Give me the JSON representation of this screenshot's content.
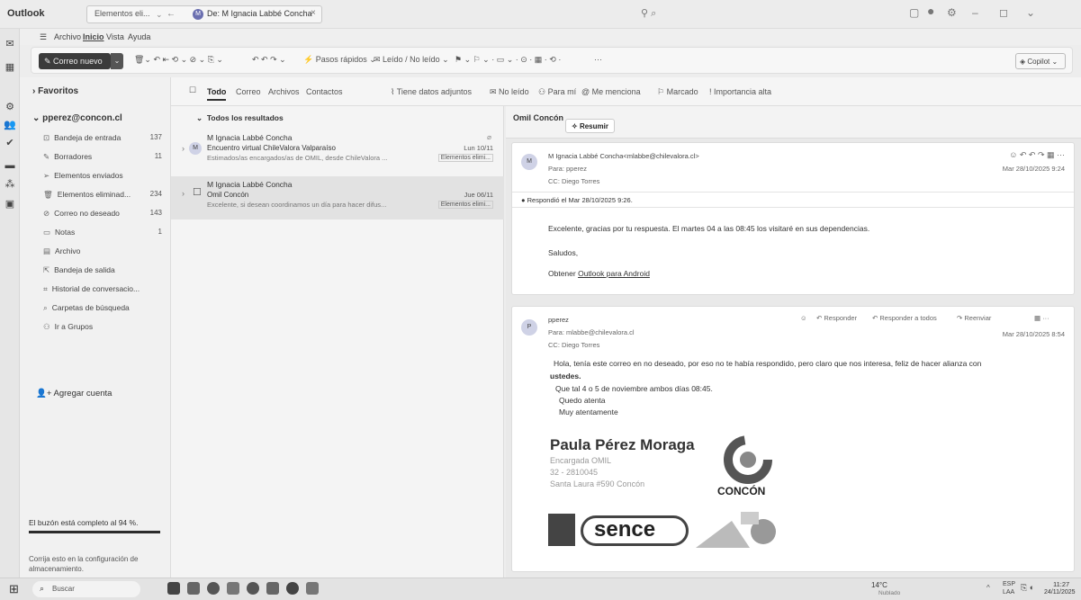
{
  "app": {
    "name": "Outlook"
  },
  "search": {
    "scope": "Elementos eli...",
    "query": "De: M Ignacia Labbé Concha",
    "avatar_initial": "M"
  },
  "menu": {
    "archivo": "Archivo",
    "inicio": "Inicio",
    "vista": "Vista",
    "ayuda": "Ayuda"
  },
  "ribbon": {
    "new_mail": "Correo nuevo",
    "quick_steps": "Pasos rápidos",
    "read_unread": "Leído / No leído",
    "more": "···",
    "copilot": "Copilot"
  },
  "folders": {
    "favorites": "Favoritos",
    "account": "pperez@concon.cl",
    "items": [
      {
        "label": "Bandeja de entrada",
        "count": "137",
        "icon": "inbox-icon"
      },
      {
        "label": "Borradores",
        "count": "11",
        "icon": "pencil-icon"
      },
      {
        "label": "Elementos enviados",
        "count": "",
        "icon": "send-icon"
      },
      {
        "label": "Elementos eliminad...",
        "count": "234",
        "icon": "trash-icon"
      },
      {
        "label": "Correo no deseado",
        "count": "143",
        "icon": "junk-icon"
      },
      {
        "label": "Notas",
        "count": "1",
        "icon": "note-icon"
      },
      {
        "label": "Archivo",
        "count": "",
        "icon": "archive-icon"
      },
      {
        "label": "Bandeja de salida",
        "count": "",
        "icon": "outbox-icon"
      },
      {
        "label": "Historial de conversacio...",
        "count": "",
        "icon": "history-icon"
      },
      {
        "label": "Carpetas de búsqueda",
        "count": "",
        "icon": "search-folder-icon"
      },
      {
        "label": "Ir a Grupos",
        "count": "",
        "icon": "groups-icon"
      }
    ],
    "add_account": "Agregar cuenta",
    "mailbox_full": "El buzón está completo al 94 %.",
    "mailbox_fix": "Corrija esto en la configuración de almacenamiento."
  },
  "filters": {
    "todo": "Todo",
    "correo": "Correo",
    "archivos": "Archivos",
    "contactos": "Contactos",
    "adjuntos": "Tiene datos adjuntos",
    "no_leido": "No leído",
    "para_mi": "Para mí",
    "menciona": "Me menciona",
    "marcado": "Marcado",
    "importancia": "Importancia alta"
  },
  "list": {
    "header": "Todos los resultados",
    "messages": [
      {
        "sender": "M Ignacia Labbé Concha",
        "subject": "Encuentro virtual ChileValora Valparaíso",
        "preview": "Estimados/as encargados/as de OMIL, desde ChileValora ...",
        "date": "Lun 10/11",
        "tag": "Elementos elimi...",
        "initial": "M"
      },
      {
        "sender": "M Ignacia Labbé Concha",
        "subject": "Omil Concón",
        "preview": "Excelente, si desean coordinamos un día para hacer difus...",
        "date": "Jue 06/11",
        "tag": "Elementos elimi...",
        "initial": ""
      }
    ]
  },
  "reading": {
    "subject": "Omil Concón",
    "summarize": "Resumir",
    "msg1": {
      "from": "M Ignacia Labbé Concha<mlabbe@chilevalora.cl>",
      "to": "Para: pperez",
      "cc": "CC: Diego Torres",
      "date": "Mar 28/10/2025 9:24",
      "initial": "M",
      "replied": "Respondió el Mar 28/10/2025 9:26.",
      "body1": "Excelente, gracias por tu respuesta. El martes 04 a las 08:45 los visitaré en sus dependencias.",
      "body2": "Saludos,",
      "body3_prefix": "Obtener ",
      "body3_link": "Outlook para Android"
    },
    "msg2": {
      "from": "pperez",
      "to": "Para: mlabbe@chilevalora.cl",
      "cc": "CC: Diego Torres",
      "date": "Mar 28/10/2025 8:54",
      "initial": "P",
      "reply": "Responder",
      "reply_all": "Responder a todos",
      "forward": "Reenviar",
      "line1": "Hola, tenía este correo en no deseado, por eso no te había respondido, pero claro que nos interesa, feliz de hacer alianza con",
      "line2": "ustedes.",
      "line3": "Que tal 4 o 5 de noviembre ambos días 08:45.",
      "line4": "Quedo atenta",
      "line5": "Muy atentamente",
      "sig_name": "Paula Pérez Moraga",
      "sig_title": "Encargada OMIL",
      "sig_phone": "32 - 2810045",
      "sig_address": "Santa Laura #590 Concón",
      "logo_text": "CONCÓN",
      "sence": "sence"
    }
  },
  "taskbar": {
    "search": "Buscar",
    "weather_temp": "14°C",
    "weather_desc": "Nublado",
    "lang1": "ESP",
    "lang2": "LAA",
    "time": "11:27",
    "date": "24/11/2025"
  }
}
